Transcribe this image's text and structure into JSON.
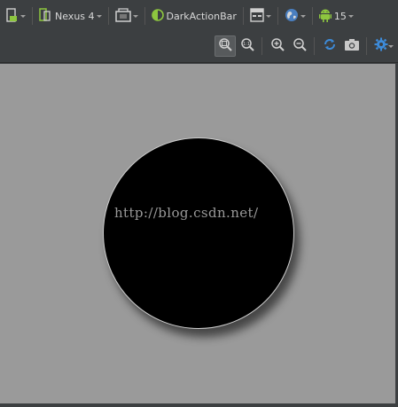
{
  "toolbar": {
    "device_label": "Nexus 4",
    "theme_label": "DarkActionBar",
    "api_label": "15"
  },
  "watermark": "http://blog.csdn.net/",
  "colors": {
    "android_green": "#8dc63f",
    "blue_accent": "#3d8bd9",
    "canvas_bg": "#9a9a9a",
    "circle_fill": "#000000"
  },
  "icons": {
    "row1": [
      "device-icon",
      "phone-icon",
      "orientation-icon",
      "theme-icon",
      "activity-layout-icon",
      "locale-globe-icon",
      "android-icon"
    ],
    "row2": [
      "zoom-to-fit-icon",
      "actual-size-icon",
      "zoom-in-icon",
      "zoom-out-icon",
      "refresh-icon",
      "screenshot-icon",
      "settings-gear-icon"
    ]
  }
}
